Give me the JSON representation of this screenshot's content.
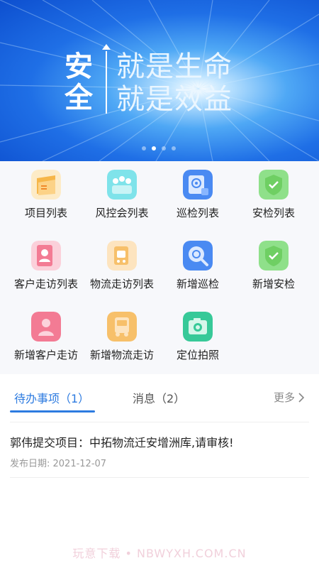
{
  "banner": {
    "title_line1": "安",
    "title_line2": "全",
    "slogan_line1": "就是生命",
    "slogan_line2": "就是效益",
    "page_dots": 4,
    "active_dot": 2
  },
  "grid": {
    "items": [
      {
        "label": "项目列表",
        "icon": "project-list-icon"
      },
      {
        "label": "风控会列表",
        "icon": "risk-meeting-icon"
      },
      {
        "label": "巡检列表",
        "icon": "inspection-list-icon"
      },
      {
        "label": "安检列表",
        "icon": "safety-check-list-icon"
      },
      {
        "label": "客户走访列表",
        "icon": "customer-visit-list-icon"
      },
      {
        "label": "物流走访列表",
        "icon": "logistics-visit-list-icon"
      },
      {
        "label": "新增巡检",
        "icon": "add-inspection-icon"
      },
      {
        "label": "新增安检",
        "icon": "add-safety-check-icon"
      },
      {
        "label": "新增客户走访",
        "icon": "add-customer-visit-icon"
      },
      {
        "label": "新增物流走访",
        "icon": "add-logistics-visit-icon"
      },
      {
        "label": "定位拍照",
        "icon": "location-photo-icon"
      }
    ]
  },
  "tabs": {
    "todo_label": "待办事项（1）",
    "message_label": "消息（2）",
    "more_label": "更多"
  },
  "todo": {
    "title": "郭伟提交项目：中拓物流迁安增洲库,请审核!",
    "date": "发布日期: 2021-12-07"
  },
  "watermark": "玩意下载 • NBWYXH.COM.CN",
  "colors": {
    "accent": "#2d7be0",
    "banner_blue": "#1f6fe6"
  }
}
